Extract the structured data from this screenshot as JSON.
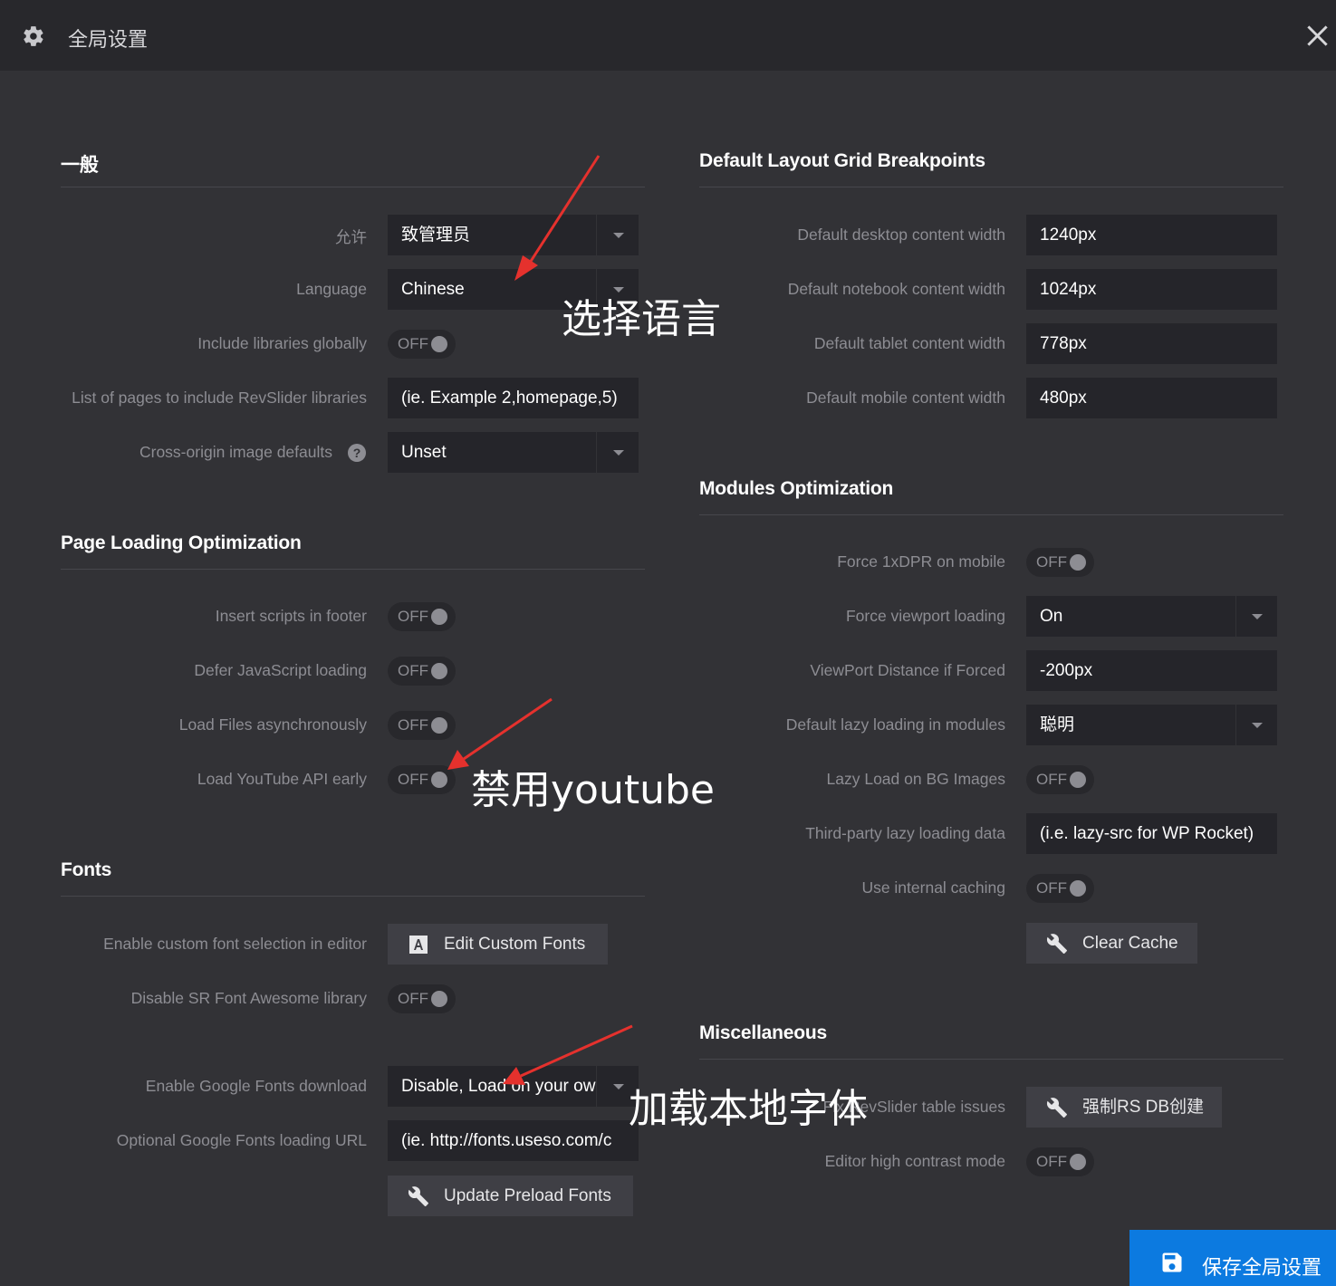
{
  "window": {
    "title": "全局设置"
  },
  "general": {
    "title": "一般",
    "permission": {
      "label": "允许",
      "value": "致管理员"
    },
    "language": {
      "label": "Language",
      "value": "Chinese"
    },
    "include_libs": {
      "label": "Include libraries globally",
      "state": "OFF"
    },
    "pages_list": {
      "label": "List of pages to include RevSlider libraries",
      "placeholder": "(ie. Example 2,homepage,5)"
    },
    "cross_origin": {
      "label": "Cross-origin image defaults",
      "value": "Unset",
      "help": "?"
    }
  },
  "page_loading": {
    "title": "Page Loading Optimization",
    "insert_footer": {
      "label": "Insert scripts in footer",
      "state": "OFF"
    },
    "defer_js": {
      "label": "Defer JavaScript loading",
      "state": "OFF"
    },
    "load_async": {
      "label": "Load Files asynchronously",
      "state": "OFF"
    },
    "youtube_api": {
      "label": "Load YouTube API early",
      "state": "OFF"
    }
  },
  "fonts": {
    "title": "Fonts",
    "custom_font": {
      "label": "Enable custom font selection in editor",
      "button": "Edit Custom Fonts"
    },
    "font_awesome": {
      "label": "Disable SR Font Awesome library",
      "state": "OFF"
    },
    "google_download": {
      "label": "Enable Google Fonts download",
      "value": "Disable, Load on your ow"
    },
    "google_url": {
      "label": "Optional Google Fonts loading URL",
      "placeholder": "(ie. http://fonts.useso.com/c"
    },
    "preload_button": "Update Preload Fonts"
  },
  "grid": {
    "title": "Default Layout Grid Breakpoints",
    "desktop": {
      "label": "Default desktop content width",
      "value": "1240px"
    },
    "notebook": {
      "label": "Default notebook content width",
      "value": "1024px"
    },
    "tablet": {
      "label": "Default tablet content width",
      "value": "778px"
    },
    "mobile": {
      "label": "Default mobile content width",
      "value": "480px"
    }
  },
  "modules": {
    "title": "Modules Optimization",
    "force_dpr": {
      "label": "Force 1xDPR on mobile",
      "state": "OFF"
    },
    "viewport_loading": {
      "label": "Force viewport loading",
      "value": "On"
    },
    "viewport_distance": {
      "label": "ViewPort Distance if Forced",
      "value": "-200px"
    },
    "lazy_loading": {
      "label": "Default lazy loading in modules",
      "value": "聪明"
    },
    "lazy_bg": {
      "label": "Lazy Load on BG Images",
      "state": "OFF"
    },
    "third_party": {
      "label": "Third-party lazy loading data",
      "placeholder": "(i.e. lazy-src for WP Rocket)"
    },
    "internal_caching": {
      "label": "Use internal caching",
      "state": "OFF"
    },
    "clear_cache_button": "Clear Cache"
  },
  "misc": {
    "title": "Miscellaneous",
    "table_issues": {
      "label": "Fix RevSlider table issues",
      "button": "强制RS DB创建"
    },
    "high_contrast": {
      "label": "Editor high contrast mode",
      "state": "OFF"
    }
  },
  "save_button": "保存全局设置",
  "annotations": {
    "language_note": "选择语言",
    "youtube_note": "禁用youtube",
    "fonts_note": "加载本地字体"
  },
  "colors": {
    "background": "#323236",
    "titlebar": "#28282c",
    "field": "#25252a",
    "label": "#8d8d93",
    "accent": "#0c7ae0",
    "annotation_arrow": "#e5312d"
  },
  "icons": {
    "window": "gear-icon",
    "close": "close-icon",
    "font": "font-letter-icon",
    "tool": "wrench-icon",
    "save": "floppy-disk-icon"
  }
}
